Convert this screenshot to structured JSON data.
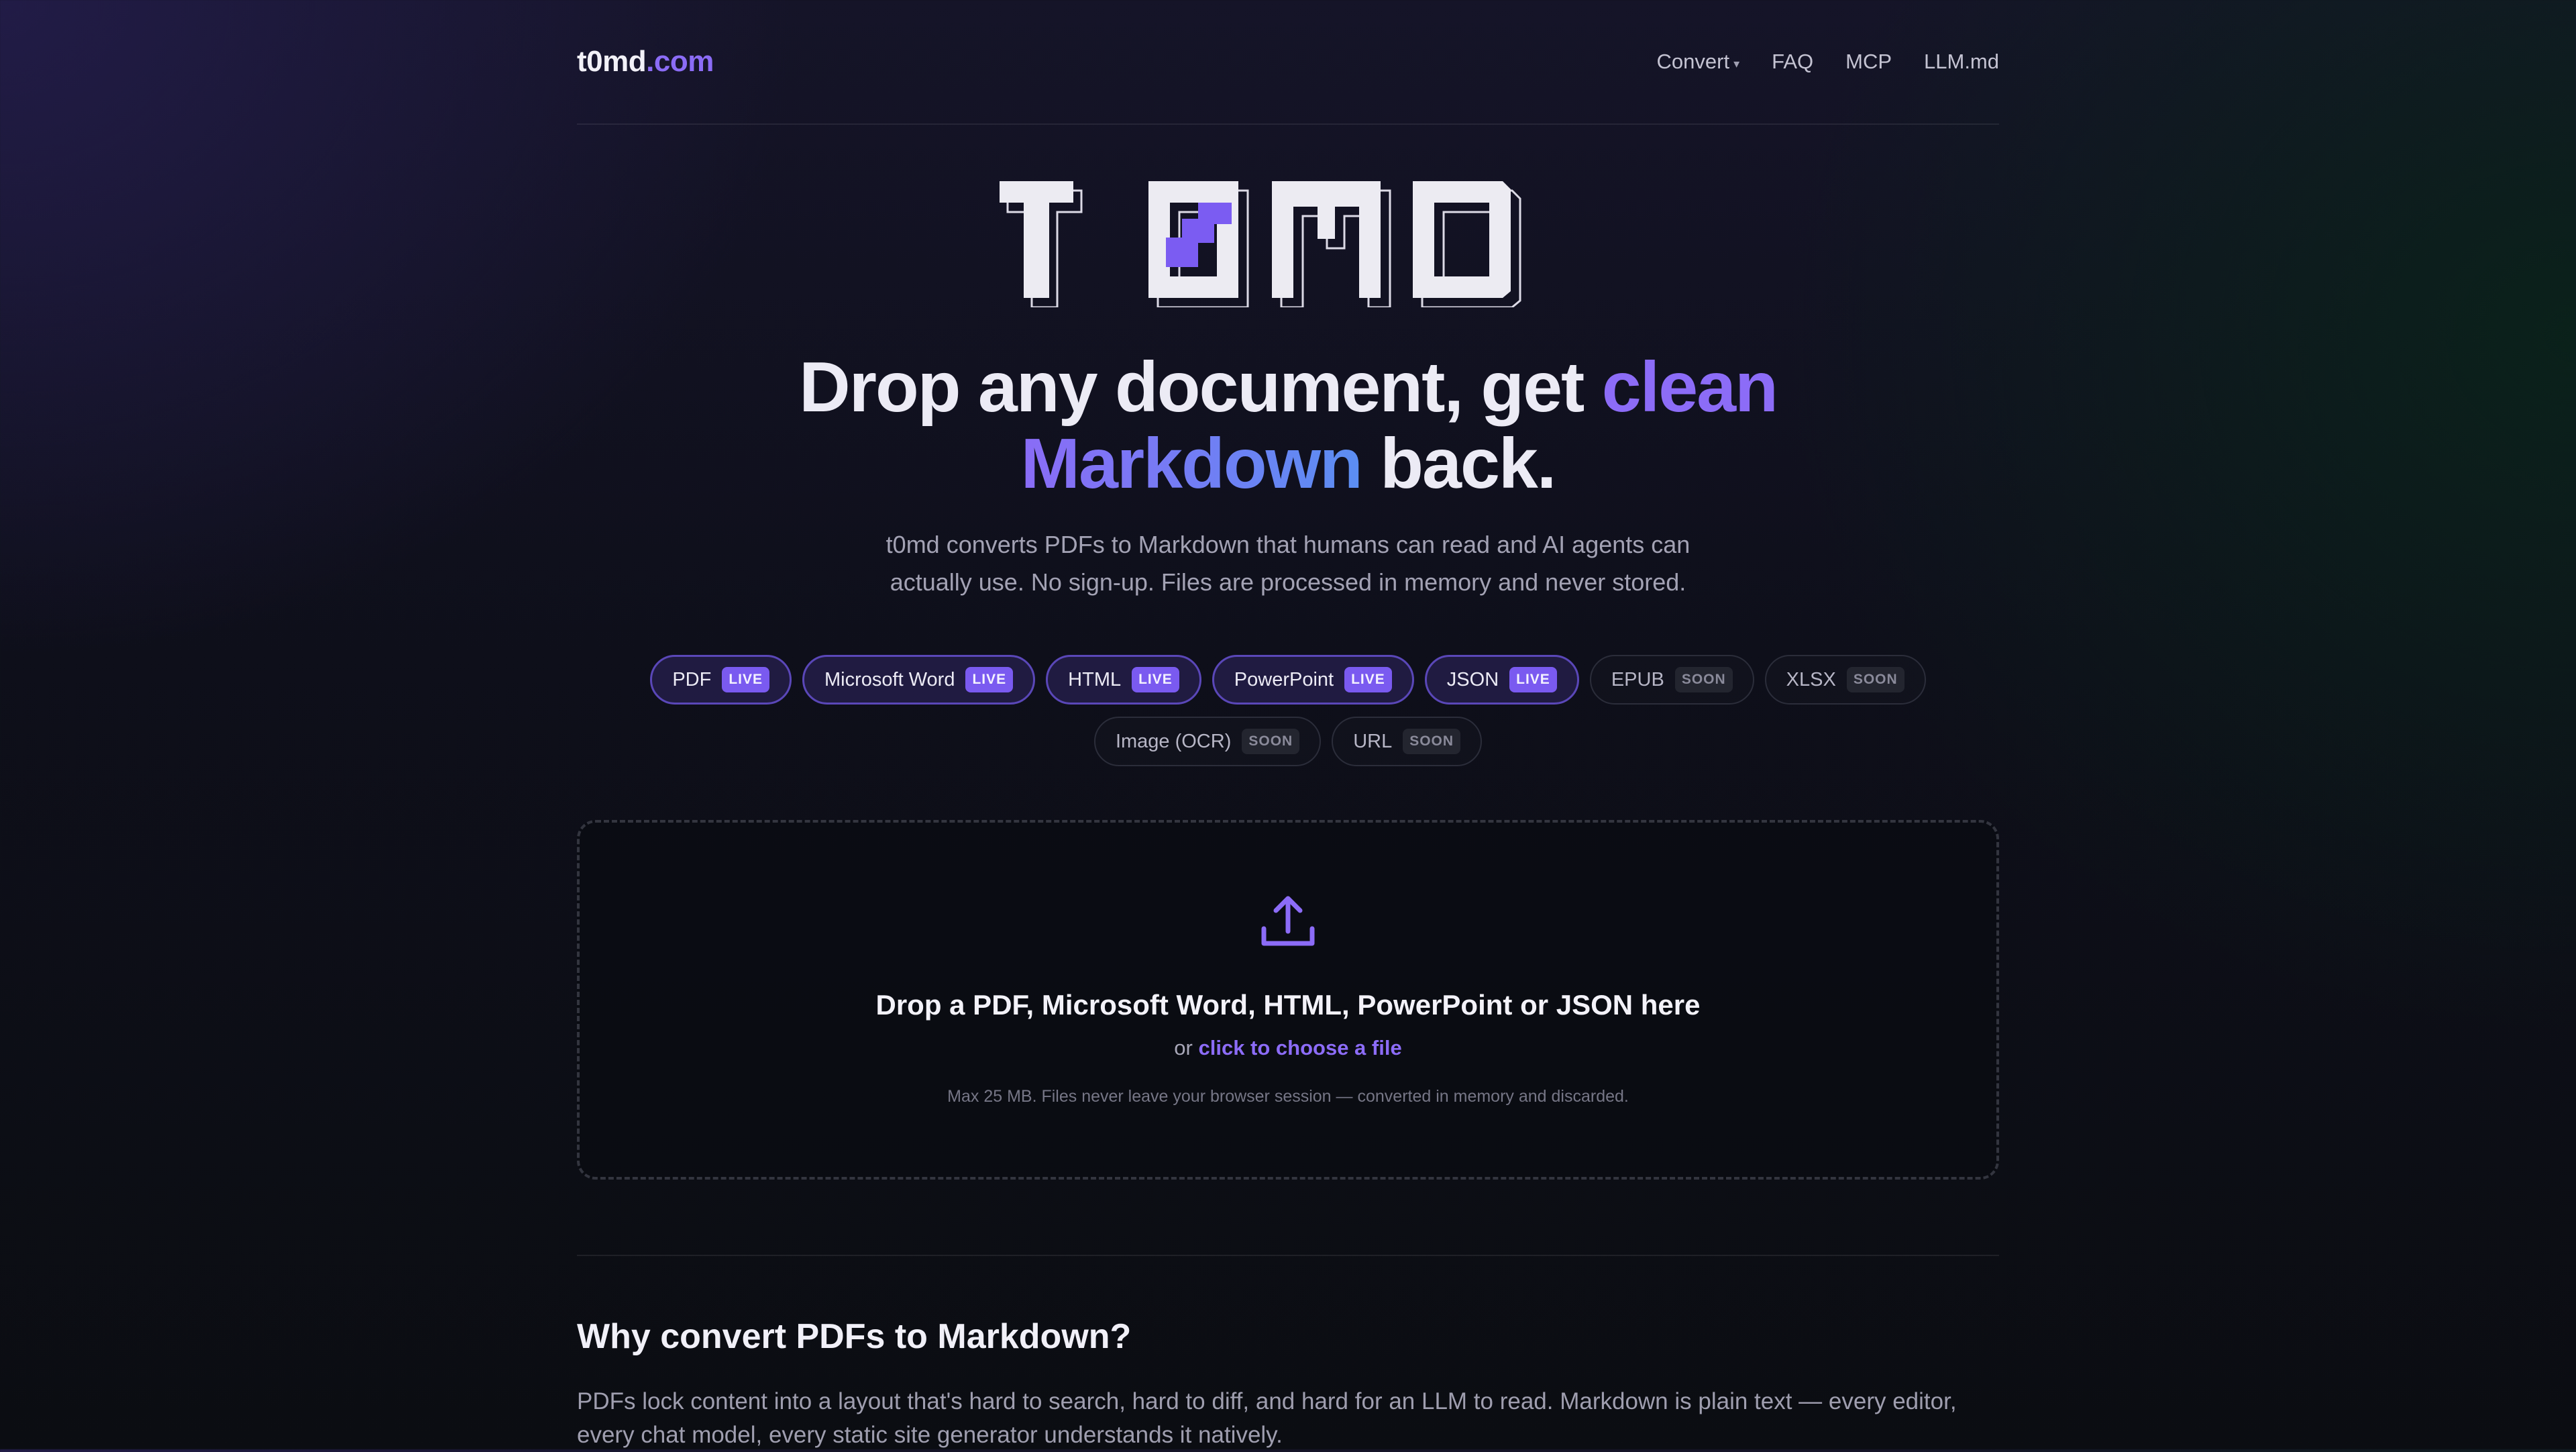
{
  "header": {
    "logo": {
      "name": "t0md",
      "tld": ".com"
    },
    "nav": [
      {
        "label": "Convert",
        "has_dropdown": true
      },
      {
        "label": "FAQ"
      },
      {
        "label": "MCP"
      },
      {
        "label": "LLM.md"
      }
    ]
  },
  "hero": {
    "logo_glyphs": "T0MD",
    "title_part1": "Drop any document, get ",
    "title_highlight1": "clean",
    "title_highlight2": "Markdown",
    "title_part2": " back.",
    "subtitle": "t0md converts PDFs to Markdown that humans can read and AI agents can actually use. No sign-up. Files are processed in memory and never stored."
  },
  "formats": [
    {
      "label": "PDF",
      "status": "LIVE"
    },
    {
      "label": "Microsoft Word",
      "status": "LIVE"
    },
    {
      "label": "HTML",
      "status": "LIVE"
    },
    {
      "label": "PowerPoint",
      "status": "LIVE"
    },
    {
      "label": "JSON",
      "status": "LIVE"
    },
    {
      "label": "EPUB",
      "status": "SOON"
    },
    {
      "label": "XLSX",
      "status": "SOON"
    },
    {
      "label": "Image (OCR)",
      "status": "SOON"
    },
    {
      "label": "URL",
      "status": "SOON"
    }
  ],
  "dropzone": {
    "icon": "upload-icon",
    "title": "Drop a PDF, Microsoft Word, HTML, PowerPoint or JSON here",
    "or_text": "or",
    "link_text": "click to choose a file",
    "note": "Max 25 MB. Files never leave your browser session — converted in memory and discarded."
  },
  "why": {
    "title": "Why convert PDFs to Markdown?",
    "body": "PDFs lock content into a layout that's hard to search, hard to diff, and hard for an LLM to read. Markdown is plain text — every editor, every chat model, every static site generator understands it natively."
  },
  "colors": {
    "accent": "#8c6cf7",
    "accent_blue": "#5b8ef2",
    "live_badge": "#7a5af0",
    "background": "#11121c"
  }
}
